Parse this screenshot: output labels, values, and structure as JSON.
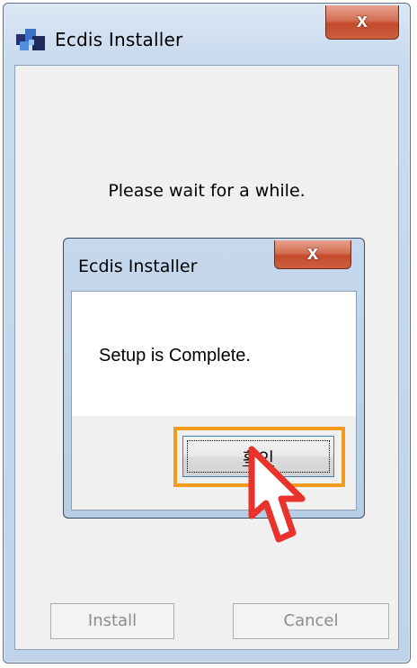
{
  "window": {
    "title": "Ecdis Installer",
    "close_symbol": "x",
    "status_text": "Please wait for a while.",
    "buttons": {
      "install": "Install",
      "cancel": "Cancel"
    }
  },
  "dialog": {
    "title": "Ecdis Installer",
    "close_symbol": "x",
    "message": "Setup is Complete.",
    "ok_label": "확인"
  },
  "colors": {
    "highlight": "#f29b1a",
    "cursor": "#e8322b",
    "close_button": "#c44a2a"
  },
  "icons": [
    "app-icon",
    "close-icon",
    "pointer-cursor-icon"
  ]
}
